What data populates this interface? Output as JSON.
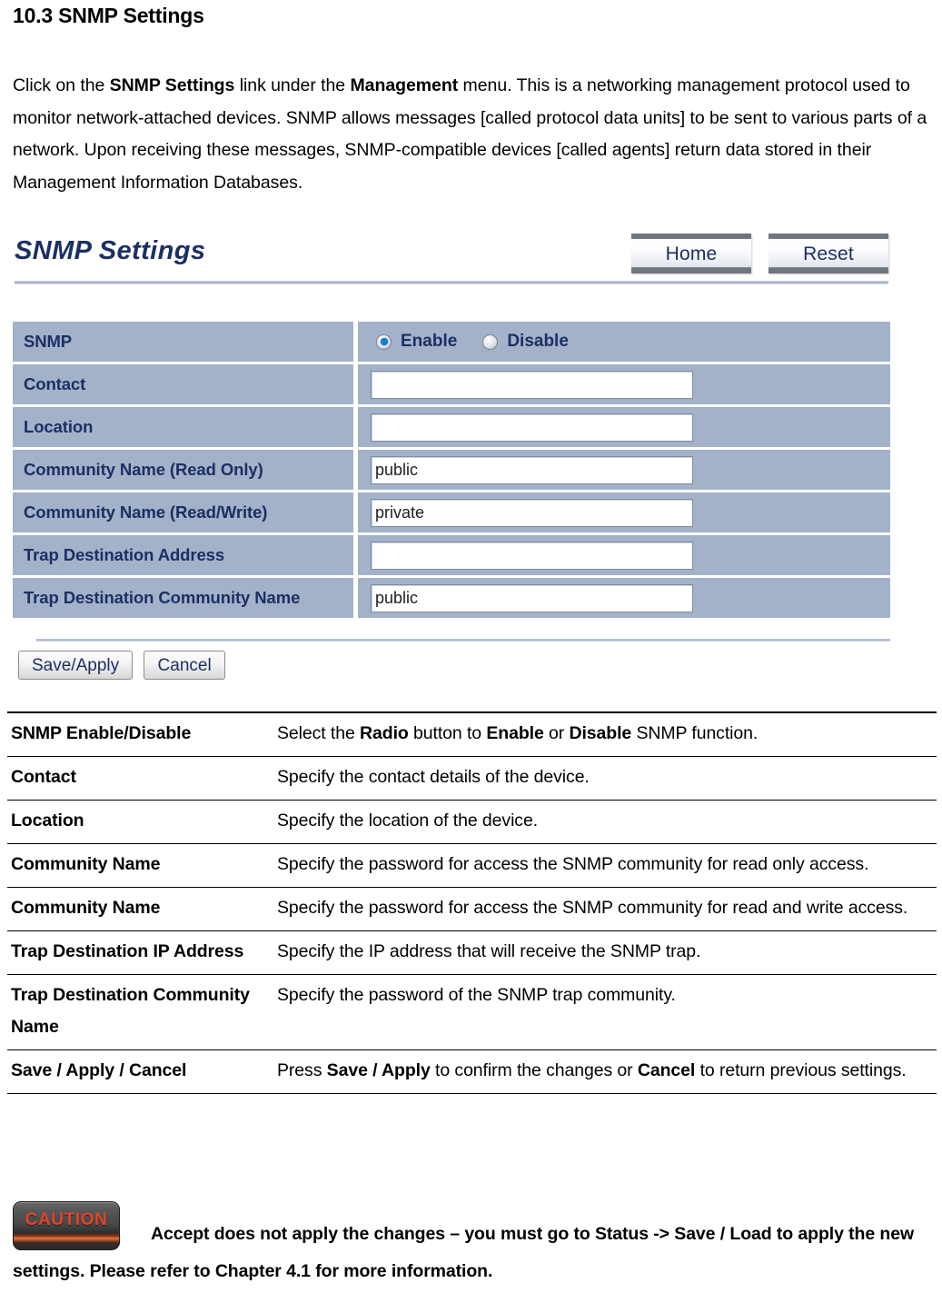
{
  "document": {
    "section_heading": "10.3 SNMP Settings",
    "intro_paragraph": {
      "segments": [
        {
          "text": "Click on the ",
          "bold": false
        },
        {
          "text": "SNMP Settings",
          "bold": true
        },
        {
          "text": " link under the ",
          "bold": false
        },
        {
          "text": "Management",
          "bold": true
        },
        {
          "text": " menu. This is a networking management protocol used to monitor network-attached devices. SNMP allows messages [called protocol data units] to be sent to various parts of a network. Upon receiving these messages, SNMP-compatible devices [called agents] return data stored in their Management Information Databases.",
          "bold": false
        }
      ]
    }
  },
  "screenshot": {
    "panel_title": "SNMP Settings",
    "header_buttons": [
      {
        "label": "Home",
        "name": "home-button"
      },
      {
        "label": "Reset",
        "name": "reset-button"
      }
    ],
    "colors": {
      "row_background": "#a3b2c9",
      "label_text": "#1b2f63",
      "radio_accent": "#0d7fd4",
      "caution_red": "#e0462a"
    },
    "rows": [
      {
        "label": "SNMP",
        "type": "radio",
        "options": [
          {
            "label": "Enable",
            "selected": true
          },
          {
            "label": "Disable",
            "selected": false
          }
        ]
      },
      {
        "label": "Contact",
        "type": "text",
        "value": "",
        "placeholder": ""
      },
      {
        "label": "Location",
        "type": "text",
        "value": "",
        "placeholder": ""
      },
      {
        "label": "Community Name (Read Only)",
        "type": "text",
        "value": "public",
        "placeholder": ""
      },
      {
        "label": "Community Name (Read/Write)",
        "type": "text",
        "value": "private",
        "placeholder": ""
      },
      {
        "label": "Trap Destination Address",
        "type": "text",
        "value": "",
        "placeholder": ""
      },
      {
        "label": "Trap Destination Community Name",
        "type": "text",
        "value": "public",
        "placeholder": ""
      }
    ],
    "footer_buttons": [
      {
        "label": "Save/Apply",
        "name": "save-apply-button"
      },
      {
        "label": "Cancel",
        "name": "cancel-button"
      }
    ]
  },
  "description_table": {
    "rows": [
      {
        "term": "SNMP Enable/Disable",
        "definition": [
          {
            "text": "Select the ",
            "bold": false
          },
          {
            "text": "Radio",
            "bold": true
          },
          {
            "text": " button to ",
            "bold": false
          },
          {
            "text": "Enable",
            "bold": true
          },
          {
            "text": " or ",
            "bold": false
          },
          {
            "text": "Disable",
            "bold": true
          },
          {
            "text": " SNMP function.",
            "bold": false
          }
        ]
      },
      {
        "term": "Contact",
        "definition": [
          {
            "text": "Specify the contact details of the device.",
            "bold": false
          }
        ]
      },
      {
        "term": "Location",
        "definition": [
          {
            "text": "Specify the location of the device.",
            "bold": false
          }
        ]
      },
      {
        "term": "Community Name",
        "definition": [
          {
            "text": "Specify the password for access the SNMP community for read only access.",
            "bold": false
          }
        ]
      },
      {
        "term": "Community Name",
        "definition": [
          {
            "text": "Specify the password for access the SNMP community for read and write access.",
            "bold": false
          }
        ]
      },
      {
        "term": "Trap Destination IP Address",
        "definition": [
          {
            "text": "Specify the IP address that will receive the SNMP trap.",
            "bold": false
          }
        ]
      },
      {
        "term": "Trap Destination Community Name",
        "definition": [
          {
            "text": "Specify the password of the SNMP trap community.",
            "bold": false
          }
        ]
      },
      {
        "term": "Save / Apply / Cancel",
        "definition": [
          {
            "text": "Press ",
            "bold": false
          },
          {
            "text": "Save / Apply",
            "bold": true
          },
          {
            "text": " to confirm the changes or ",
            "bold": false
          },
          {
            "text": "Cancel",
            "bold": true
          },
          {
            "text": " to return previous settings.",
            "bold": false
          }
        ]
      }
    ]
  },
  "caution": {
    "badge_label": "CAUTION",
    "text": "Accept does not apply the changes – you must go to Status -> Save / Load to apply the new settings. Please refer to Chapter 4.1 for more information."
  }
}
